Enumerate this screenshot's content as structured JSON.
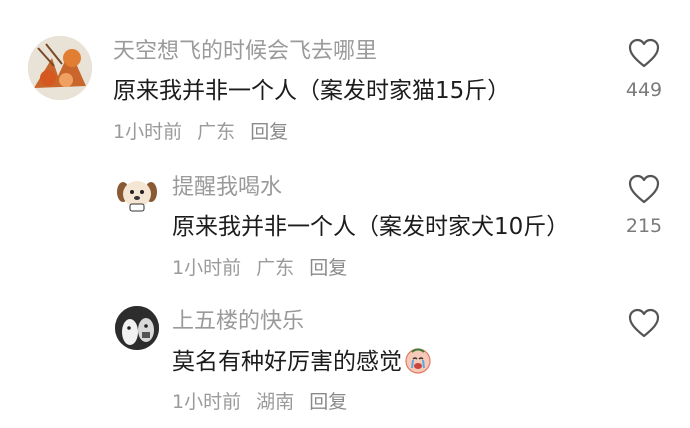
{
  "comments": [
    {
      "username": "天空想飞的时候会飞去哪里",
      "content": "原来我并非一个人（案发时家猫15斤）",
      "time": "1小时前",
      "location": "广东",
      "reply_label": "回复",
      "like_count": "449",
      "avatar_icon": "autumn-leaves-avatar"
    },
    {
      "username": "提醒我喝水",
      "content": "原来我并非一个人（案发时家犬10斤）",
      "time": "1小时前",
      "location": "广东",
      "reply_label": "回复",
      "like_count": "215",
      "avatar_icon": "cartoon-dog-avatar"
    },
    {
      "username": "上五楼的快乐",
      "content": "莫名有种好厉害的感觉",
      "time": "1小时前",
      "location": "湖南",
      "reply_label": "回复",
      "like_count": "",
      "avatar_icon": "cartoon-figure-avatar",
      "emoji": "crying-face-emoji"
    }
  ],
  "colors": {
    "username": "#9a9a9a",
    "content": "#1c1c1c",
    "meta": "#9a9a9a",
    "heart_outline": "#555555"
  }
}
